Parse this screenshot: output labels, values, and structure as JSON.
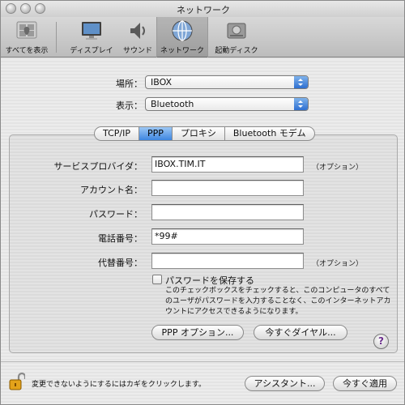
{
  "window": {
    "title": "ネットワーク"
  },
  "toolbar": {
    "items": [
      {
        "label": "すべてを表示",
        "icon": "apple-logo-icon"
      },
      {
        "label": "ディスプレイ",
        "icon": "display-icon"
      },
      {
        "label": "サウンド",
        "icon": "speaker-icon"
      },
      {
        "label": "ネットワーク",
        "icon": "network-globe-icon",
        "selected": true
      },
      {
        "label": "起動ディスク",
        "icon": "hard-disk-icon"
      }
    ]
  },
  "location": {
    "label": "場所：",
    "value": "IBOX"
  },
  "show": {
    "label": "表示：",
    "value": "Bluetooth"
  },
  "tabs": [
    {
      "label": "TCP/IP",
      "active": false
    },
    {
      "label": "PPP",
      "active": true
    },
    {
      "label": "プロキシ",
      "active": false
    },
    {
      "label": "Bluetooth モデム",
      "active": false
    }
  ],
  "form": {
    "service_provider": {
      "label": "サービスプロバイダ：",
      "value": "IBOX.TIM.IT",
      "note": "（オプション）"
    },
    "account": {
      "label": "アカウント名：",
      "value": ""
    },
    "password": {
      "label": "パスワード：",
      "value": ""
    },
    "phone": {
      "label": "電話番号：",
      "value": "*99#"
    },
    "alt_phone": {
      "label": "代替番号：",
      "value": "",
      "note": "（オプション）"
    },
    "save_password": {
      "label": "パスワードを保存する",
      "checked": false,
      "help": "このチェックボックスをチェックすると、このコンピュータのすべてのユーザがパスワードを入力することなく、このインターネットアカウントにアクセスできるようになります。"
    }
  },
  "buttons": {
    "ppp_options": "PPP オプション...",
    "dial_now": "今すぐダイヤル...",
    "help": "?",
    "assistant": "アシスタント...",
    "apply_now": "今すぐ適用"
  },
  "footer": {
    "lock_text": "変更できないようにするにはカギをクリックします。"
  },
  "colors": {
    "accent": "#3d86e0",
    "help_question": "#6a2d8c"
  }
}
